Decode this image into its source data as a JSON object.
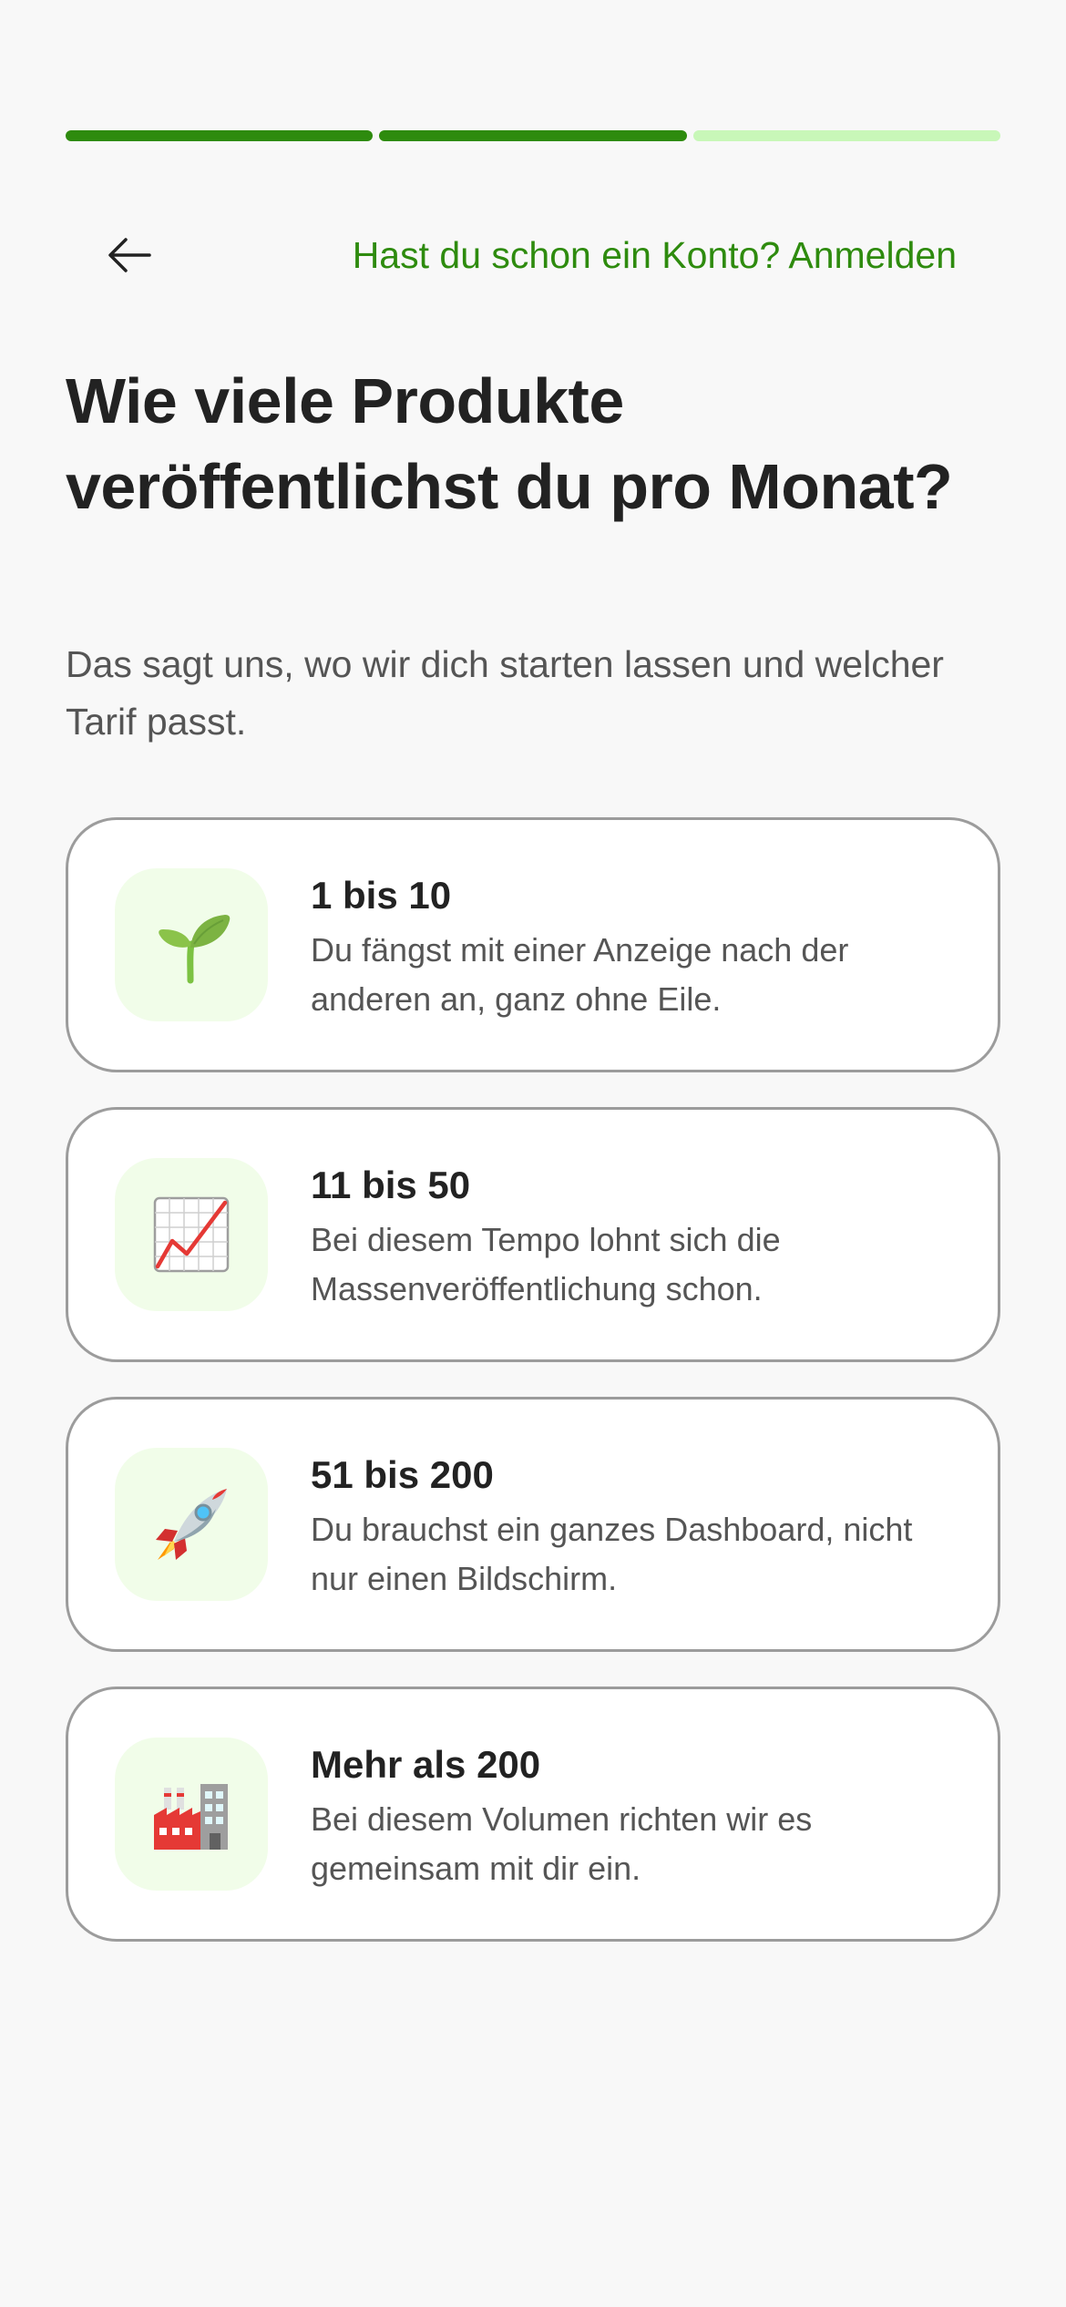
{
  "progress": {
    "total_steps": 3,
    "completed_steps": 2,
    "colors": {
      "done": "#2e8b0e",
      "pending": "#c8f7b8"
    }
  },
  "header": {
    "back_icon": "arrow-left-icon",
    "login_text": "Hast du schon ein Konto? Anmelden",
    "login_color": "#2e8b0e"
  },
  "question": {
    "title": "Wie viele Produkte veröffentlichst du pro Monat?",
    "subtitle": "Das sagt uns, wo wir dich starten lassen und welcher Tarif passt."
  },
  "options": [
    {
      "title": "1 bis 10",
      "description": "Du fängst mit einer Anzeige nach der anderen an, ganz ohne Eile.",
      "icon": "seedling-icon"
    },
    {
      "title": "11 bis 50",
      "description": "Bei diesem Tempo lohnt sich die Massenveröffentlichung schon.",
      "icon": "chart-increasing-icon"
    },
    {
      "title": "51 bis 200",
      "description": "Du brauchst ein ganzes Dashboard, nicht nur einen Bildschirm.",
      "icon": "rocket-icon"
    },
    {
      "title": "Mehr als 200",
      "description": "Bei diesem Volumen richten wir es gemeinsam mit dir ein.",
      "icon": "factory-icon"
    }
  ]
}
